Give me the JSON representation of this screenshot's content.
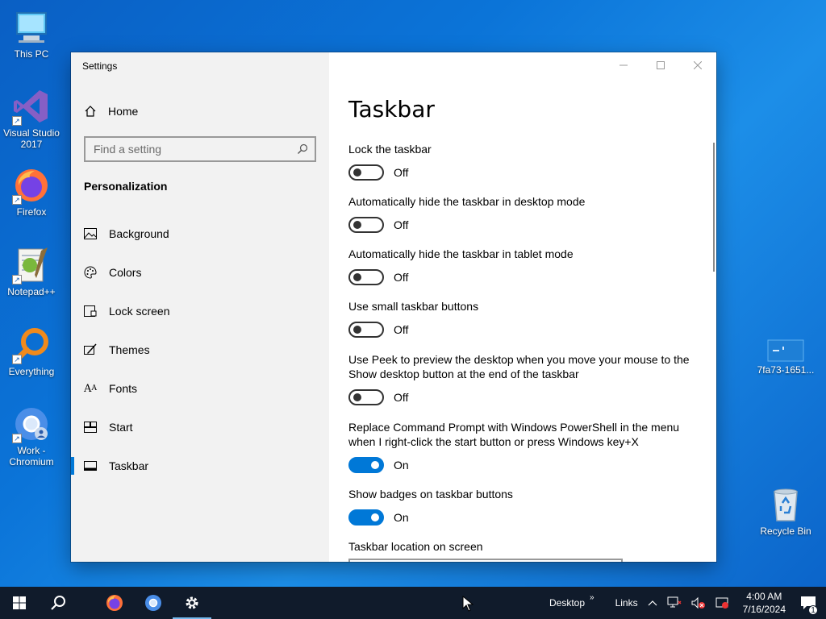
{
  "desktop": {
    "icons": [
      {
        "label": "This PC",
        "icon": "computer-icon"
      },
      {
        "label": "Visual Studio 2017",
        "icon": "visual-studio-icon"
      },
      {
        "label": "Firefox",
        "icon": "firefox-icon"
      },
      {
        "label": "Notepad++",
        "icon": "notepadpp-icon"
      },
      {
        "label": "Everything",
        "icon": "everything-search-icon"
      },
      {
        "label": "Work - Chromium",
        "icon": "chromium-icon"
      },
      {
        "label": "7fa73-1651...",
        "icon": "file-icon"
      },
      {
        "label": "Recycle Bin",
        "icon": "recycle-bin-icon"
      }
    ]
  },
  "window": {
    "title": "Settings",
    "sidebar": {
      "home_label": "Home",
      "search_placeholder": "Find a setting",
      "section_title": "Personalization",
      "items": [
        {
          "label": "Background",
          "icon": "picture-icon"
        },
        {
          "label": "Colors",
          "icon": "palette-icon"
        },
        {
          "label": "Lock screen",
          "icon": "lock-screen-icon"
        },
        {
          "label": "Themes",
          "icon": "themes-brush-icon"
        },
        {
          "label": "Fonts",
          "icon": "fonts-icon"
        },
        {
          "label": "Start",
          "icon": "start-tiles-icon"
        },
        {
          "label": "Taskbar",
          "icon": "taskbar-icon",
          "selected": true
        }
      ]
    },
    "content": {
      "page_title": "Taskbar",
      "settings": [
        {
          "label": "Lock the taskbar",
          "state": "Off"
        },
        {
          "label": "Automatically hide the taskbar in desktop mode",
          "state": "Off"
        },
        {
          "label": "Automatically hide the taskbar in tablet mode",
          "state": "Off"
        },
        {
          "label": "Use small taskbar buttons",
          "state": "Off"
        },
        {
          "label": "Use Peek to preview the desktop when you move your mouse to the Show desktop button at the end of the taskbar",
          "state": "Off"
        },
        {
          "label": "Replace Command Prompt with Windows PowerShell in the menu when I right-click the start button or press Windows key+X",
          "state": "On"
        },
        {
          "label": "Show badges on taskbar buttons",
          "state": "On"
        }
      ],
      "location_label": "Taskbar location on screen"
    }
  },
  "taskbar": {
    "desktop_toolbar": "Desktop",
    "links_toolbar": "Links",
    "time": "4:00 AM",
    "date": "7/16/2024",
    "notification_count": "1",
    "accent": "#0078d7"
  }
}
